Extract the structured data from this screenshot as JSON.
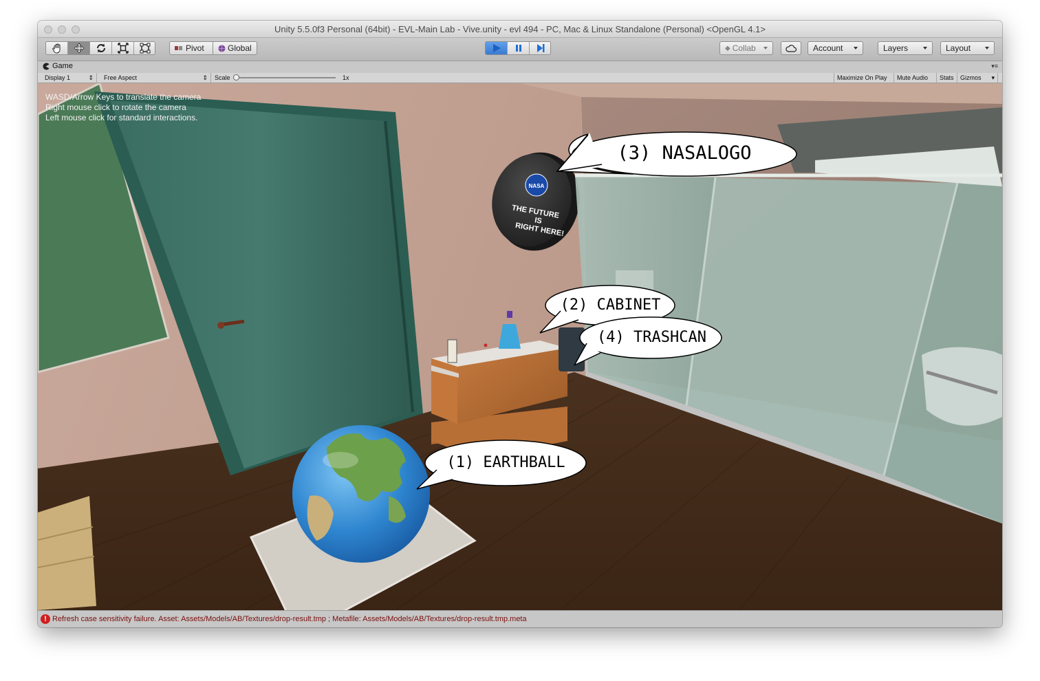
{
  "window": {
    "title": "Unity 5.5.0f3 Personal (64bit) - EVL-Main Lab - Vive.unity - evl 494 - PC, Mac & Linux Standalone (Personal) <OpenGL 4.1>"
  },
  "toolbar": {
    "tools": [
      "hand-icon",
      "move-icon",
      "rotate-icon",
      "scale-icon",
      "rect-icon"
    ],
    "pivot_label": "Pivot",
    "global_label": "Global",
    "collab_label": "Collab",
    "account_label": "Account",
    "layers_label": "Layers",
    "layout_label": "Layout",
    "play_color": "#2f7de1"
  },
  "game_view": {
    "tab_label": "Game",
    "display_label": "Display 1",
    "aspect_label": "Free Aspect",
    "scale_label": "Scale",
    "scale_value": "1x",
    "maximize_label": "Maximize On Play",
    "mute_label": "Mute Audio",
    "stats_label": "Stats",
    "gizmos_label": "Gizmos"
  },
  "help_text": [
    "WASD/Arrow Keys to translate the camera",
    "Right mouse click to rotate the camera",
    "Left mouse click for standard interactions."
  ],
  "scene": {
    "sign_lines": [
      "NASA",
      "THE FUTURE",
      "IS",
      "RIGHT HERE!"
    ]
  },
  "callouts": [
    {
      "label": "(3) NASALOGO"
    },
    {
      "label": "(2) CABINET"
    },
    {
      "label": "(4) TRASHCAN"
    },
    {
      "label": "(1) EARTHBALL"
    }
  ],
  "status": {
    "message": "Refresh case sensitivity failure. Asset: Assets/Models/AB/Textures/drop-result.tmp ; Metafile: Assets/Models/AB/Textures/drop-result.tmp.meta",
    "error_color": "#d21e1e"
  }
}
